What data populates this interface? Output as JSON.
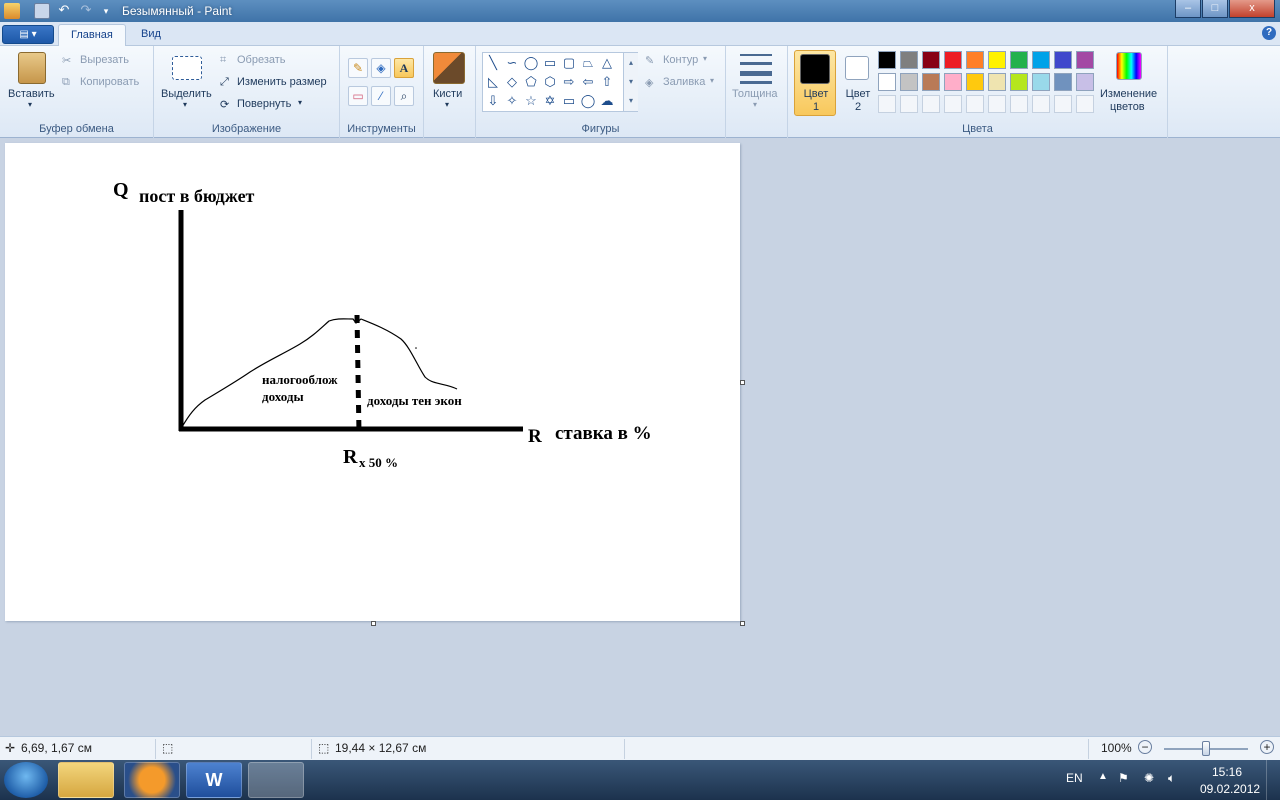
{
  "window": {
    "title": "Безымянный - Paint",
    "buttons": {
      "minimize": "–",
      "maximize": "□",
      "close": "x"
    }
  },
  "ribbon_tabs": {
    "home": "Главная",
    "view": "Вид",
    "help": "?"
  },
  "groups": {
    "clipboard": {
      "label": "Буфер обмена",
      "paste": "Вставить",
      "cut": "Вырезать",
      "copy": "Копировать"
    },
    "image": {
      "label": "Изображение",
      "select": "Выделить",
      "crop": "Обрезать",
      "resize": "Изменить размер",
      "rotate": "Повернуть"
    },
    "tools": {
      "label": "Инструменты",
      "text_tool": "A"
    },
    "brushes": {
      "label": "Кисти"
    },
    "shapes": {
      "label": "Фигуры",
      "outline": "Контур",
      "fill": "Заливка"
    },
    "size": {
      "label": "Толщина"
    },
    "colors": {
      "label": "Цвета",
      "color1": "Цвет 1",
      "color2": "Цвет 2",
      "edit_colors_line1": "Изменение",
      "edit_colors_line2": "цветов"
    }
  },
  "palette": {
    "row1": [
      "#000000",
      "#7f7f7f",
      "#880015",
      "#ed1c24",
      "#ff7f27",
      "#fff200",
      "#22b14c",
      "#00a2e8",
      "#3f48cc",
      "#a349a4"
    ],
    "row2": [
      "#ffffff",
      "#c3c3c3",
      "#b97a57",
      "#ffaec9",
      "#ffc90e",
      "#efe4b0",
      "#b5e61d",
      "#99d9ea",
      "#7092be",
      "#c8bfe7"
    ],
    "color1": "#000000",
    "color2": "#ffffff"
  },
  "drawing": {
    "y_symbol": "Q",
    "y_label": "пост в бюджет",
    "x_symbol": "R",
    "x_label": "ставка в %",
    "left_label_line1": "налогооблож",
    "left_label_line2": "доходы",
    "right_label": "доходы тен экон",
    "marker_symbol": "R",
    "marker_sub": "х 50 %"
  },
  "statusbar": {
    "cursor_pos": "6,69, 1,67 см",
    "canvas_size": "19,44 × 12,67 см",
    "zoom": "100%"
  },
  "taskbar": {
    "lang": "EN",
    "time": "15:16",
    "date": "09.02.2012"
  }
}
